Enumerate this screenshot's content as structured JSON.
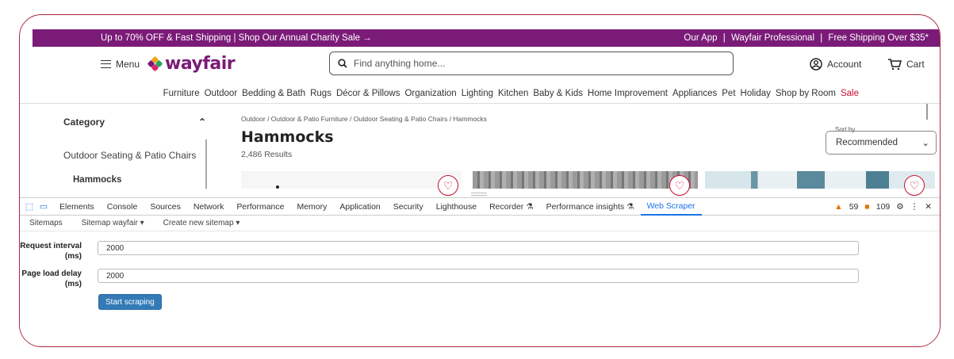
{
  "promo": {
    "left": "Up to 70% OFF & Fast Shipping | Shop Our Annual Charity Sale →",
    "right": [
      "Our App",
      "|",
      "Wayfair Professional",
      "|",
      "Free Shipping Over $35*"
    ]
  },
  "header": {
    "menu_label": "Menu",
    "logo": "wayfair",
    "search_placeholder": "Find anything home...",
    "account_label": "Account",
    "cart_label": "Cart"
  },
  "category_nav": [
    "Furniture",
    "Outdoor",
    "Bedding & Bath",
    "Rugs",
    "Décor & Pillows",
    "Organization",
    "Lighting",
    "Kitchen",
    "Baby & Kids",
    "Home Improvement",
    "Appliances",
    "Pet",
    "Holiday",
    "Shop by Room",
    "Sale"
  ],
  "filter": {
    "heading": "Category",
    "item": "Outdoor Seating & Patio Chairs",
    "sub": "Hammocks"
  },
  "main": {
    "breadcrumb": "Outdoor / Outdoor & Patio Furniture / Outdoor Seating & Patio Chairs / Hammocks",
    "title": "Hammocks",
    "results": "2,486 Results",
    "sort_label": "Sort by",
    "sort_value": "Recommended"
  },
  "devtools": {
    "tabs": [
      "Elements",
      "Console",
      "Sources",
      "Network",
      "Performance",
      "Memory",
      "Application",
      "Security",
      "Lighthouse",
      "Recorder ⚗",
      "Performance insights ⚗",
      "Web Scraper"
    ],
    "active_tab": "Web Scraper",
    "warnings": "59",
    "issues": "109",
    "subnav": [
      "Sitemaps",
      "Sitemap wayfair ▾",
      "Create new sitemap ▾"
    ],
    "request_interval_label": "Request interval (ms)",
    "request_interval_value": "2000",
    "page_load_label": "Page load delay (ms)",
    "page_load_value": "2000",
    "start_button": "Start scraping"
  },
  "colors": {
    "brand": "#7b1b78",
    "sale": "#c8102e",
    "devtools_accent": "#1a73e8",
    "button": "#337ab7"
  }
}
